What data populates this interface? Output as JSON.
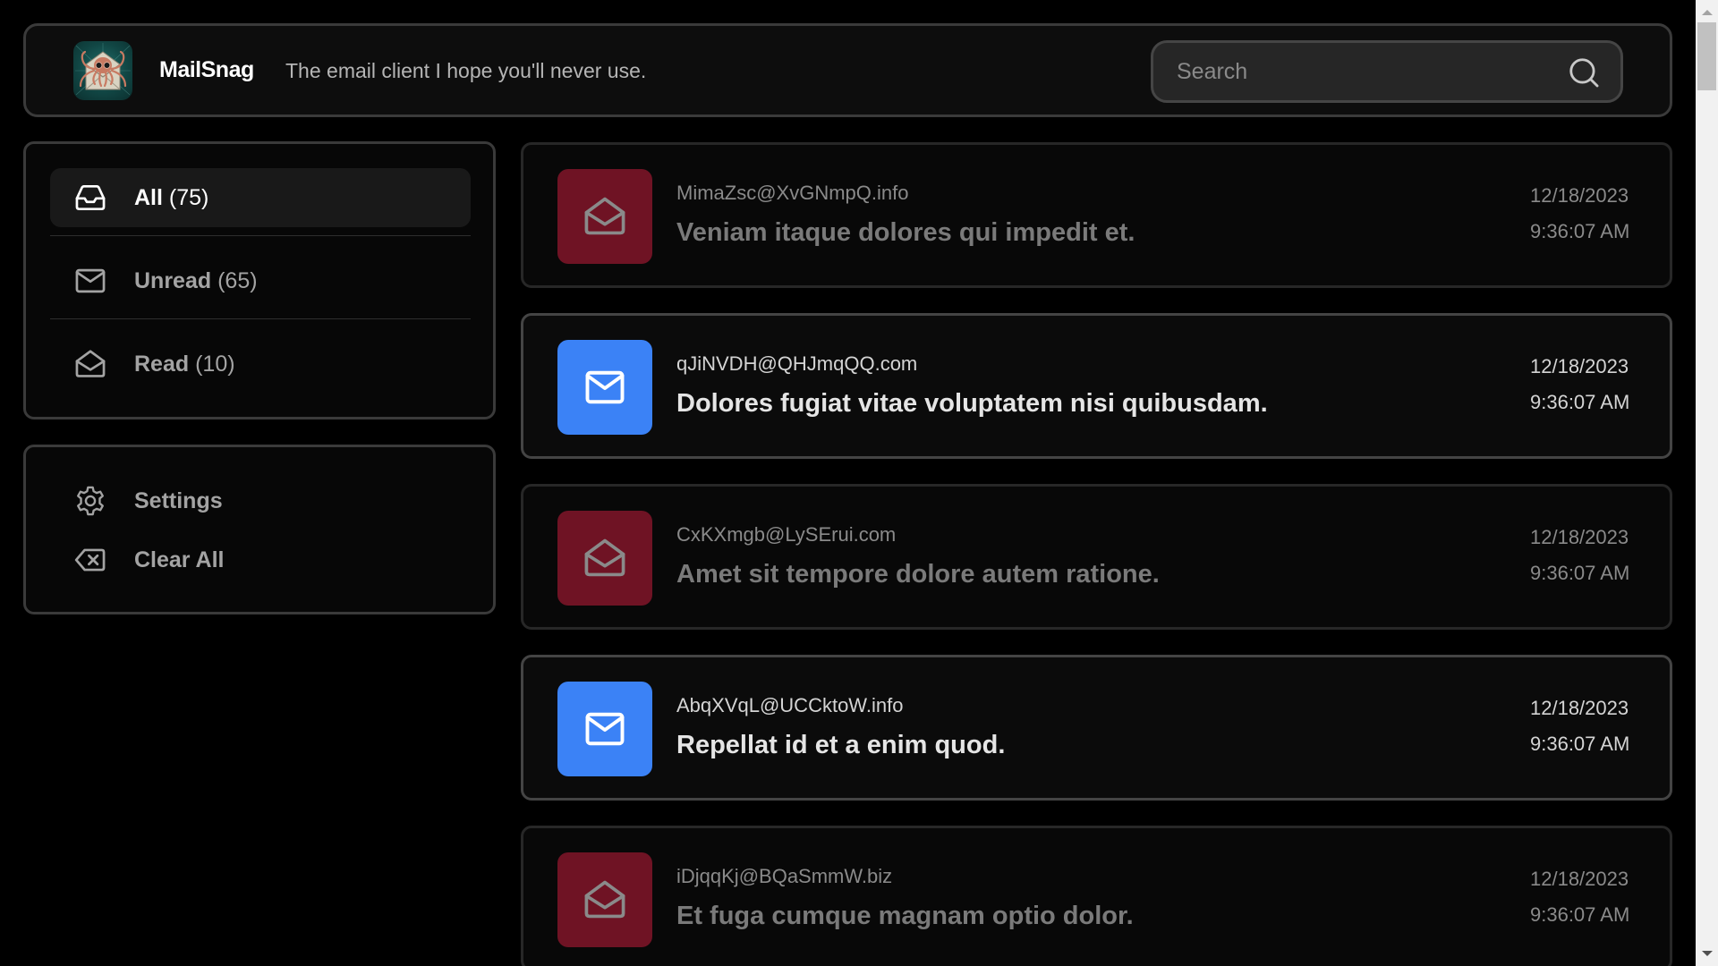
{
  "header": {
    "app_title": "MailSnag",
    "tagline": "The email client I hope you'll never use.",
    "logo_icon": "octopus-envelope-logo",
    "search": {
      "placeholder": "Search",
      "value": "",
      "icon": "search-icon"
    }
  },
  "sidebar": {
    "filters": [
      {
        "label": "All",
        "count": "(75)",
        "icon": "inbox-icon",
        "active": true
      },
      {
        "label": "Unread",
        "count": "(65)",
        "icon": "envelope-closed-icon",
        "active": false
      },
      {
        "label": "Read",
        "count": "(10)",
        "icon": "envelope-open-icon",
        "active": false
      }
    ],
    "actions": [
      {
        "label": "Settings",
        "icon": "gear-icon"
      },
      {
        "label": "Clear All",
        "icon": "backspace-x-icon"
      }
    ]
  },
  "emails": [
    {
      "status": "read",
      "sender": "MimaZsc@XvGNmpQ.info",
      "subject": "Veniam itaque dolores qui impedit et.",
      "date": "12/18/2023",
      "time": "9:36:07 AM"
    },
    {
      "status": "unread",
      "sender": "qJiNVDH@QHJmqQQ.com",
      "subject": "Dolores fugiat vitae voluptatem nisi quibusdam.",
      "date": "12/18/2023",
      "time": "9:36:07 AM"
    },
    {
      "status": "read",
      "sender": "CxKXmgb@LySErui.com",
      "subject": "Amet sit tempore dolore autem ratione.",
      "date": "12/18/2023",
      "time": "9:36:07 AM"
    },
    {
      "status": "unread",
      "sender": "AbqXVqL@UCCktoW.info",
      "subject": "Repellat id et a enim quod.",
      "date": "12/18/2023",
      "time": "9:36:07 AM"
    },
    {
      "status": "read",
      "sender": "iDjqqKj@BQaSmmW.biz",
      "subject": "Et fuga cumque magnam optio dolor.",
      "date": "12/18/2023",
      "time": "9:36:07 AM"
    }
  ],
  "colors": {
    "unread_icon_bg": "#3b82f6",
    "read_icon_bg": "#6f1324",
    "background": "#000000",
    "panel_bg": "#0d0d0d",
    "border": "#3a3a3a"
  }
}
